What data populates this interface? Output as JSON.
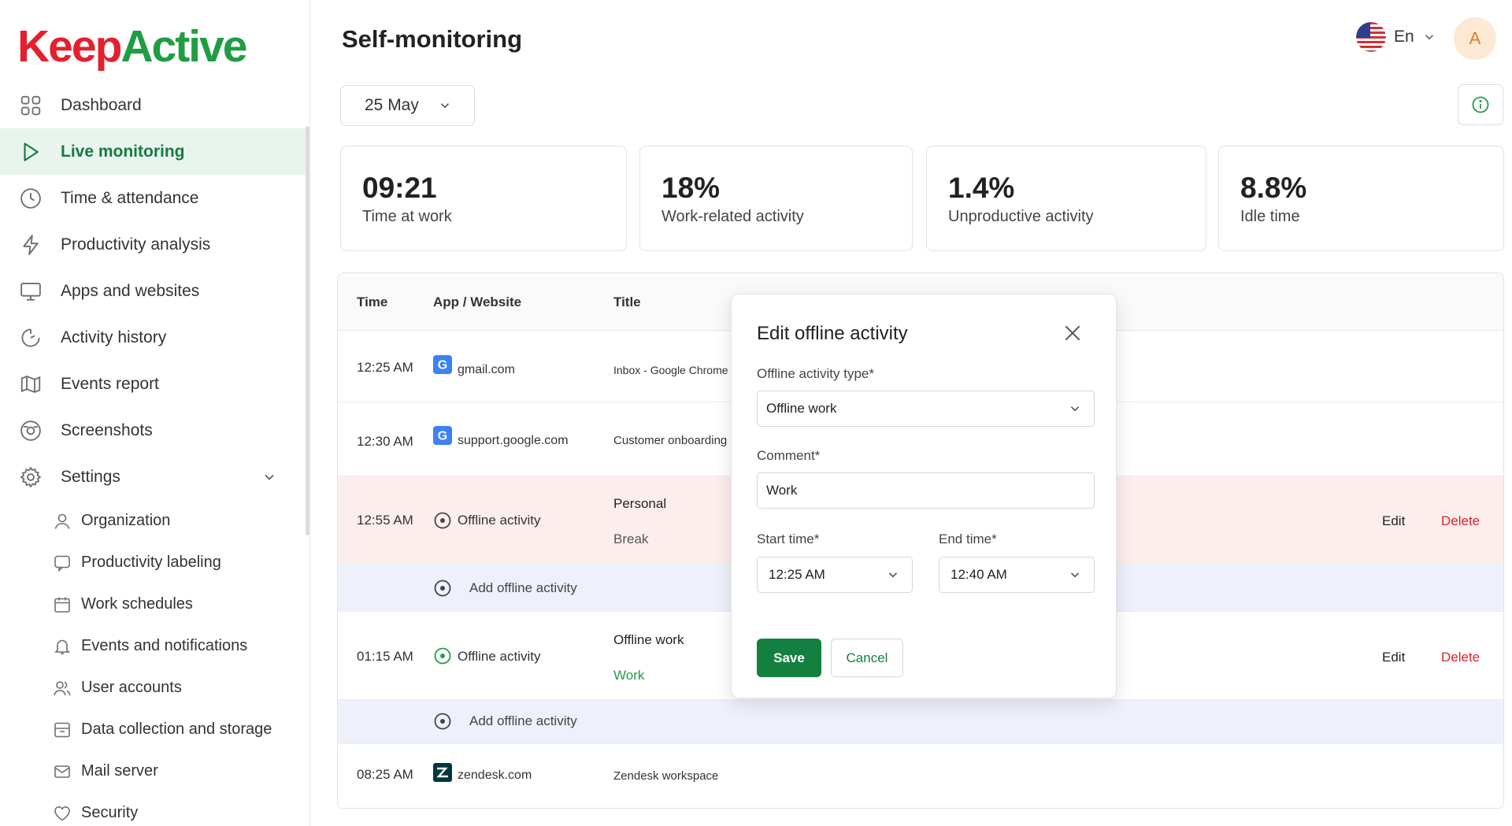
{
  "brand": {
    "part1": "Keep",
    "part2": "Active"
  },
  "header": {
    "title": "Self-monitoring",
    "language": "En",
    "avatar_initial": "A"
  },
  "nav": {
    "items": [
      {
        "label": "Dashboard",
        "icon": "grid-icon"
      },
      {
        "label": "Live monitoring",
        "icon": "play-icon",
        "active": true
      },
      {
        "label": "Time & attendance",
        "icon": "clock-icon"
      },
      {
        "label": "Productivity analysis",
        "icon": "lightning-icon"
      },
      {
        "label": "Apps and websites",
        "icon": "monitor-icon"
      },
      {
        "label": "Activity history",
        "icon": "history-icon"
      },
      {
        "label": "Events report",
        "icon": "map-icon"
      },
      {
        "label": "Screenshots",
        "icon": "camera-icon"
      },
      {
        "label": "Settings",
        "icon": "gear-icon"
      }
    ],
    "settings_items": [
      {
        "label": "Organization",
        "icon": "user-icon"
      },
      {
        "label": "Productivity labeling",
        "icon": "chat-icon"
      },
      {
        "label": "Work schedules",
        "icon": "calendar-icon"
      },
      {
        "label": "Events and notifications",
        "icon": "bell-icon"
      },
      {
        "label": "User accounts",
        "icon": "users-icon"
      },
      {
        "label": "Data collection and storage",
        "icon": "box-icon"
      },
      {
        "label": "Mail server",
        "icon": "mail-icon"
      },
      {
        "label": "Security",
        "icon": "heart-icon"
      }
    ]
  },
  "filters": {
    "date": "25 May"
  },
  "stats": [
    {
      "value": "09:21",
      "label": "Time at work"
    },
    {
      "value": "18%",
      "label": "Work-related activity"
    },
    {
      "value": "1.4%",
      "label": "Unproductive activity"
    },
    {
      "value": "8.8%",
      "label": "Idle time"
    }
  ],
  "table": {
    "headers": {
      "time": "Time",
      "app": "App / Website",
      "title": "Title"
    },
    "rows": [
      {
        "time": "12:25 AM",
        "app": "gmail.com",
        "title": "Inbox - Google Chrome"
      },
      {
        "time": "12:30 AM",
        "app": "support.google.com",
        "title": "Customer onboarding"
      },
      {
        "time": "12:55 AM",
        "app": "Offline activity",
        "title": "Personal",
        "subtitle": "Break",
        "edit": "Edit",
        "delete": "Delete"
      },
      {
        "add": "Add offline activity"
      },
      {
        "time": "01:15 AM",
        "app": "Offline activity",
        "title": "Offline work",
        "subtitle": "Work",
        "edit": "Edit",
        "delete": "Delete"
      },
      {
        "add": "Add offline activity"
      },
      {
        "time": "08:25 AM",
        "app": "zendesk.com",
        "title": "Zendesk workspace"
      }
    ]
  },
  "modal": {
    "title": "Edit offline activity",
    "type_label": "Offline activity type*",
    "type_value": "Offline work",
    "comment_label": "Comment*",
    "comment_value": "Work",
    "start_label": "Start time*",
    "start_value": "12:25 AM",
    "end_label": "End time*",
    "end_value": "12:40 AM",
    "save": "Save",
    "cancel": "Cancel"
  },
  "colors": {
    "brand_red": "#e4202e",
    "brand_green": "#1f9d43",
    "accent_green": "#14803f",
    "delete_red": "#e0202e",
    "offline_row_bg": "#fdeeee",
    "add_row_bg": "#eef0fb"
  }
}
